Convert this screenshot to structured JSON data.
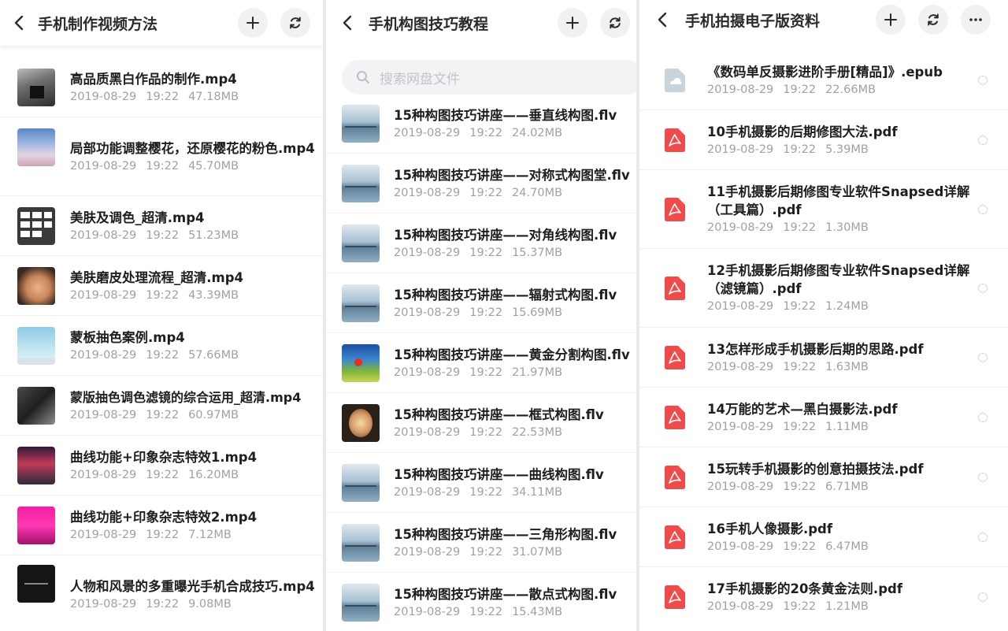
{
  "panels": [
    {
      "title": "手机制作视频方法",
      "files": [
        {
          "name": "高品质黑白作品的制作.mp4",
          "date": "2019-08-29",
          "time": "19:22",
          "size": "47.18MB"
        },
        {
          "name": "局部功能调整樱花，还原樱花的粉色.mp4",
          "date": "2019-08-29",
          "time": "19:22",
          "size": "45.70MB"
        },
        {
          "name": "美肤及调色_超清.mp4",
          "date": "2019-08-29",
          "time": "19:22",
          "size": "51.23MB"
        },
        {
          "name": "美肤磨皮处理流程_超清.mp4",
          "date": "2019-08-29",
          "time": "19:22",
          "size": "43.39MB"
        },
        {
          "name": "蒙板抽色案例.mp4",
          "date": "2019-08-29",
          "time": "19:22",
          "size": "57.66MB"
        },
        {
          "name": "蒙版抽色调色滤镜的综合运用_超清.mp4",
          "date": "2019-08-29",
          "time": "19:22",
          "size": "60.97MB"
        },
        {
          "name": "曲线功能+印象杂志特效1.mp4",
          "date": "2019-08-29",
          "time": "19:22",
          "size": "16.20MB"
        },
        {
          "name": "曲线功能+印象杂志特效2.mp4",
          "date": "2019-08-29",
          "time": "19:22",
          "size": "7.12MB"
        },
        {
          "name": "人物和风景的多重曝光手机合成技巧.mp4",
          "date": "2019-08-29",
          "time": "19:22",
          "size": "9.08MB"
        }
      ]
    },
    {
      "title": "手机构图技巧教程",
      "search_placeholder": "搜索网盘文件",
      "files": [
        {
          "name": "15种构图技巧讲座——垂直线构图.flv",
          "date": "2019-08-29",
          "time": "19:22",
          "size": "24.02MB"
        },
        {
          "name": "15种构图技巧讲座——对称式构图堂.flv",
          "date": "2019-08-29",
          "time": "19:22",
          "size": "24.70MB"
        },
        {
          "name": "15种构图技巧讲座——对角线构图.flv",
          "date": "2019-08-29",
          "time": "19:22",
          "size": "15.37MB"
        },
        {
          "name": "15种构图技巧讲座——辐射式构图.flv",
          "date": "2019-08-29",
          "time": "19:22",
          "size": "15.69MB"
        },
        {
          "name": "15种构图技巧讲座——黄金分割构图.flv",
          "date": "2019-08-29",
          "time": "19:22",
          "size": "21.97MB"
        },
        {
          "name": "15种构图技巧讲座——框式构图.flv",
          "date": "2019-08-29",
          "time": "19:22",
          "size": "22.53MB"
        },
        {
          "name": "15种构图技巧讲座——曲线构图.flv",
          "date": "2019-08-29",
          "time": "19:22",
          "size": "34.11MB"
        },
        {
          "name": "15种构图技巧讲座——三角形构图.flv",
          "date": "2019-08-29",
          "time": "19:22",
          "size": "31.07MB"
        },
        {
          "name": "15种构图技巧讲座——散点式构图.flv",
          "date": "2019-08-29",
          "time": "19:22",
          "size": "15.43MB"
        }
      ]
    },
    {
      "title": "手机拍摄电子版资料",
      "files": [
        {
          "name": "《数码单反摄影进阶手册[精品]》.epub",
          "date": "2019-08-29",
          "time": "19:22",
          "size": "22.66MB",
          "icon": "epub-file-icon"
        },
        {
          "name": "10手机摄影的后期修图大法.pdf",
          "date": "2019-08-29",
          "time": "19:22",
          "size": "5.39MB",
          "icon": "pdf-file-icon"
        },
        {
          "name": "11手机摄影后期修图专业软件Snapsed详解（工具篇）.pdf",
          "date": "2019-08-29",
          "time": "19:22",
          "size": "1.30MB",
          "icon": "pdf-file-icon"
        },
        {
          "name": "12手机摄影后期修图专业软件Snapsed详解（滤镜篇）.pdf",
          "date": "2019-08-29",
          "time": "19:22",
          "size": "1.24MB",
          "icon": "pdf-file-icon"
        },
        {
          "name": "13怎样形成手机摄影后期的思路.pdf",
          "date": "2019-08-29",
          "time": "19:22",
          "size": "1.63MB",
          "icon": "pdf-file-icon"
        },
        {
          "name": "14万能的艺术—黑白摄影法.pdf",
          "date": "2019-08-29",
          "time": "19:22",
          "size": "1.11MB",
          "icon": "pdf-file-icon"
        },
        {
          "name": "15玩转手机摄影的创意拍摄技法.pdf",
          "date": "2019-08-29",
          "time": "19:22",
          "size": "6.71MB",
          "icon": "pdf-file-icon"
        },
        {
          "name": "16手机人像摄影.pdf",
          "date": "2019-08-29",
          "time": "19:22",
          "size": "6.47MB",
          "icon": "pdf-file-icon"
        },
        {
          "name": "17手机摄影的20条黄金法则.pdf",
          "date": "2019-08-29",
          "time": "19:22",
          "size": "1.21MB",
          "icon": "pdf-file-icon"
        }
      ]
    }
  ],
  "colors": {
    "pdf_red": "#ef4b4b",
    "epub_gray": "#c9d3dc",
    "meta_text": "#a0a0a6",
    "title_text": "#2b2b2b"
  }
}
